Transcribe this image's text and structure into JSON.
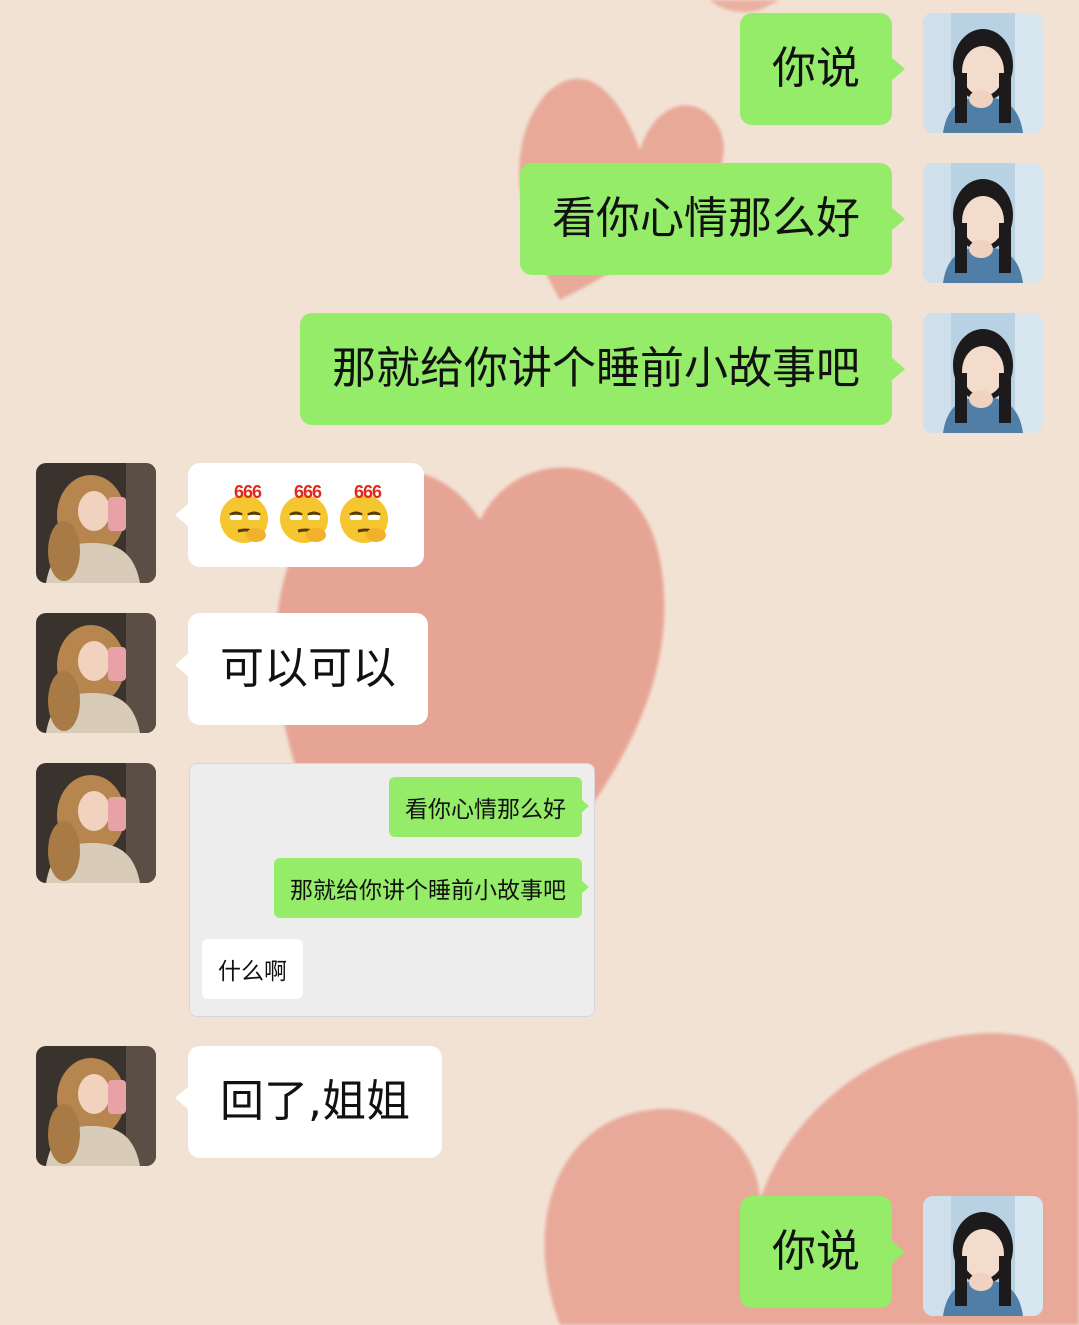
{
  "messages": [
    {
      "side": "right",
      "text": "你说"
    },
    {
      "side": "right",
      "text": "看你心情那么好"
    },
    {
      "side": "right",
      "text": "那就给你讲个睡前小故事吧"
    },
    {
      "side": "left",
      "type": "emoji",
      "emoji_label": "666",
      "emoji_count": 3,
      "emoji_name": "smug-666-emoji"
    },
    {
      "side": "left",
      "text": "可以可以"
    },
    {
      "side": "left",
      "type": "quoted-chat",
      "quoted": [
        {
          "side": "right",
          "text": "看你心情那么好"
        },
        {
          "side": "right",
          "text": "那就给你讲个睡前小故事吧"
        },
        {
          "side": "left",
          "text": "什么啊"
        }
      ]
    },
    {
      "side": "left",
      "text": "回了,姐姐"
    },
    {
      "side": "right",
      "text": "你说"
    }
  ],
  "colors": {
    "background": "#f2e2d4",
    "heart": "#e08f80",
    "sent_bubble": "#95ec69",
    "received_bubble": "#ffffff",
    "quote_card": "#ededed"
  },
  "avatars": {
    "self": "avatar-girl-blue-shirt",
    "other": "avatar-girl-mirror-selfie"
  }
}
